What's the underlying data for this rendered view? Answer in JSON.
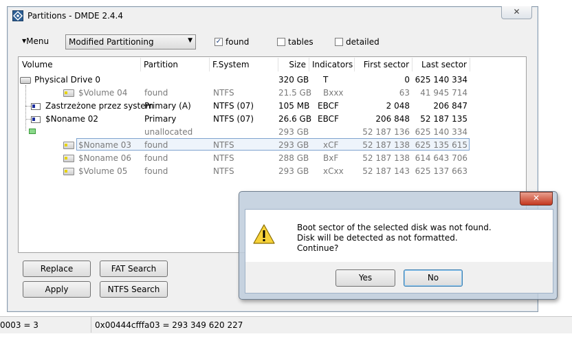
{
  "window": {
    "title": "Partitions - DMDE 2.4.4",
    "close_glyph": "✕"
  },
  "toolbar": {
    "menu_label": "Menu",
    "partitioning_value": "Modified Partitioning",
    "found_label": "found",
    "found_checked": true,
    "tables_label": "tables",
    "tables_checked": false,
    "detailed_label": "detailed",
    "detailed_checked": false
  },
  "table": {
    "headers": [
      "Volume",
      "Partition",
      "F.System",
      "Size",
      "Indicators",
      "First sector",
      "Last sector"
    ],
    "rows": [
      {
        "volume": "Physical Drive 0",
        "partition": "",
        "fs": "",
        "size": "320 GB",
        "indicators": "T",
        "first": "0",
        "last": "625 140 334"
      },
      {
        "volume": "$Volume 04",
        "partition": "found",
        "fs": "NTFS",
        "size": "21.5 GB",
        "indicators": "Bxxx",
        "first": "63",
        "last": "41 945 714"
      },
      {
        "volume": "Zastrzeżone przez system",
        "partition": "Primary (A)",
        "fs": "NTFS (07)",
        "size": "105 MB",
        "indicators": "EBCF",
        "first": "2 048",
        "last": "206 847"
      },
      {
        "volume": "$Noname 02",
        "partition": "Primary",
        "fs": "NTFS (07)",
        "size": "26.6 GB",
        "indicators": "EBCF",
        "first": "206 848",
        "last": "52 187 135"
      },
      {
        "volume": "",
        "partition": "unallocated",
        "fs": "",
        "size": "293 GB",
        "indicators": "",
        "first": "52 187 136",
        "last": "625 140 334"
      },
      {
        "volume": "$Noname 03",
        "partition": "found",
        "fs": "NTFS",
        "size": "293 GB",
        "indicators": "xCF",
        "first": "52 187 138",
        "last": "625 135 615"
      },
      {
        "volume": "$Noname 06",
        "partition": "found",
        "fs": "NTFS",
        "size": "288 GB",
        "indicators": "BxF",
        "first": "52 187 138",
        "last": "614 643 706"
      },
      {
        "volume": "$Volume 05",
        "partition": "found",
        "fs": "NTFS",
        "size": "293 GB",
        "indicators": "xCxx",
        "first": "52 187 143",
        "last": "625 137 663"
      }
    ]
  },
  "buttons": {
    "replace": "Replace",
    "fat_search": "FAT Search",
    "apply": "Apply",
    "ntfs_search": "NTFS Search"
  },
  "status": {
    "left": "0003 = 3",
    "right": "0x00444cfffa03 = 293 349 620 227"
  },
  "dialog": {
    "close_glyph": "✕",
    "line1": "Boot sector of the selected disk was not found.",
    "line2": "Disk will be detected as not formatted.",
    "line3": "Continue?",
    "yes": "Yes",
    "no": "No"
  }
}
